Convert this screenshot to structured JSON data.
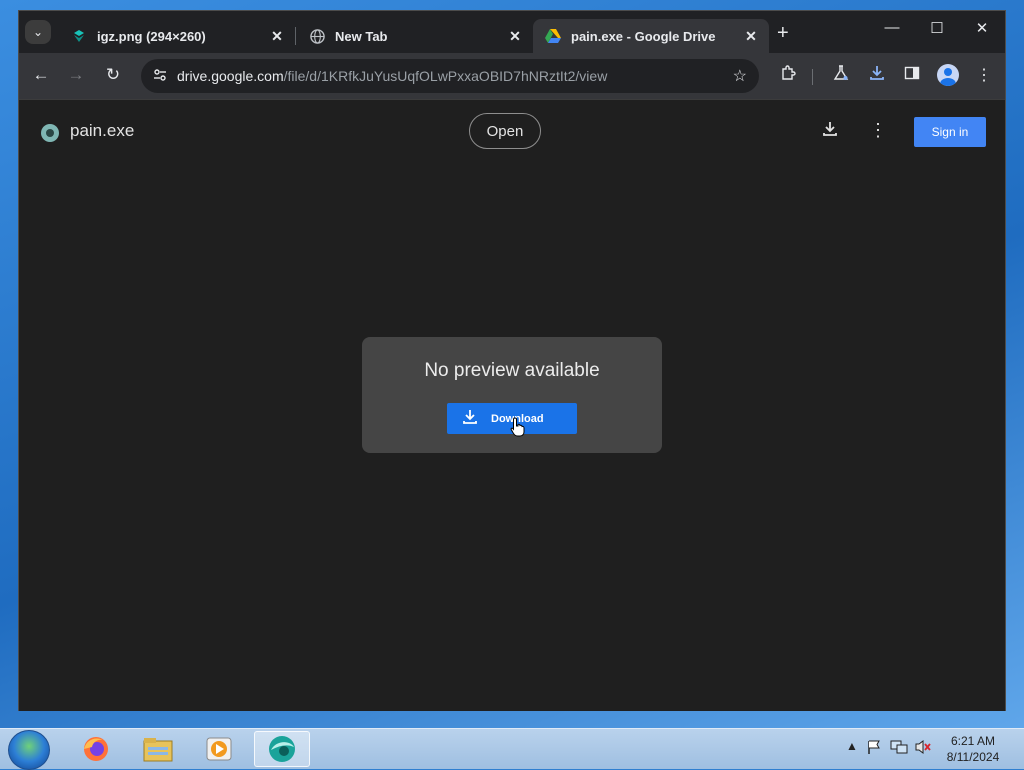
{
  "browser": {
    "tabs": [
      {
        "title": "igz.png (294×260)",
        "icon": "teal-logo-icon",
        "active": false
      },
      {
        "title": "New Tab",
        "icon": "globe-icon",
        "active": false
      },
      {
        "title": "pain.exe - Google Drive",
        "icon": "google-drive-icon",
        "active": true
      }
    ],
    "address": {
      "host": "drive.google.com",
      "path": "/file/d/1KRfkJuYusUqfOLwPxxaOBID7hNRztIt2/view"
    }
  },
  "drive": {
    "file_name": "pain.exe",
    "open_label": "Open",
    "sign_in_label": "Sign in",
    "no_preview_text": "No preview available",
    "download_label": "Download",
    "accent_color": "#1a73e8"
  },
  "taskbar": {
    "time": "6:21 AM",
    "date": "8/11/2024",
    "apps": [
      "firefox-icon",
      "file-explorer-icon",
      "media-player-icon",
      "browser-app-icon"
    ]
  }
}
